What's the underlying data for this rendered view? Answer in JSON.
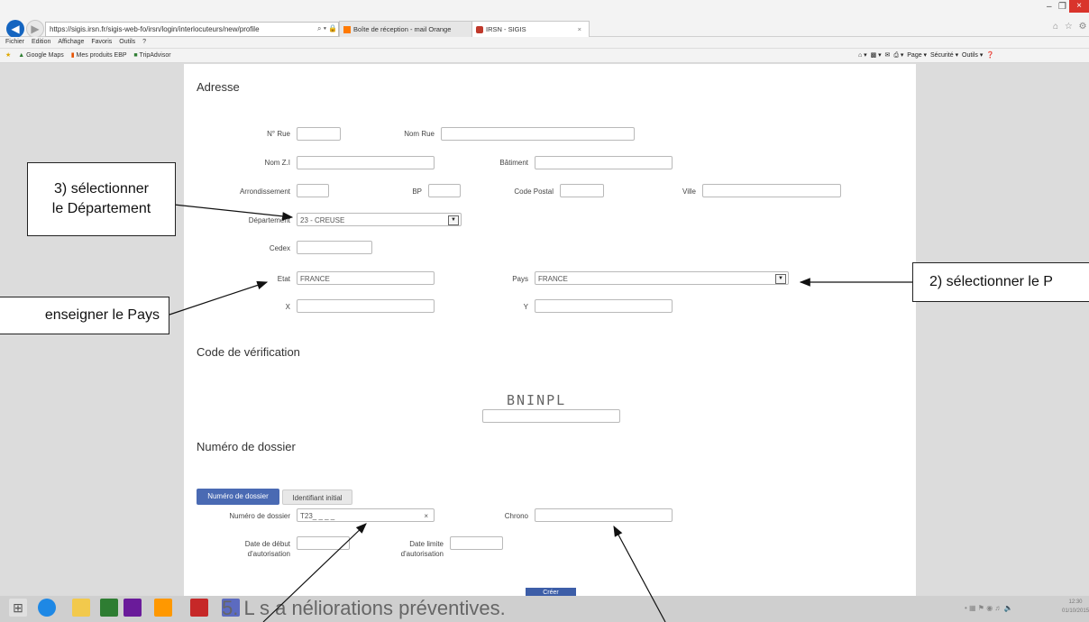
{
  "browser": {
    "url": "https://sigis.irsn.fr/sigis-web-fo/irsn/login/interlocuteurs/new/profile",
    "address_controls": "⌕ ▾ 🔒 C",
    "tabs": [
      {
        "label": "Boîte de réception - mail Orange"
      },
      {
        "label": "IRSN - SIGIS",
        "close": "×"
      }
    ],
    "window_controls": {
      "min": "–",
      "max": "❐",
      "close": "×"
    },
    "toolbar_icons": "⌂ ☆ ⚙",
    "menu": [
      "Fichier",
      "Edition",
      "Affichage",
      "Favoris",
      "Outils",
      "?"
    ],
    "favorites": [
      "Google Maps",
      "Mes produits EBP",
      "TripAdvisor"
    ],
    "command_bar": [
      "Page ▾",
      "Sécurité ▾",
      "Outils ▾"
    ]
  },
  "form": {
    "address_heading": "Adresse",
    "labels": {
      "num_rue": "N° Rue",
      "nom_rue": "Nom Rue",
      "nom_zi": "Nom Z.I",
      "batiment": "Bâtiment",
      "arrondissement": "Arrondissement",
      "bp": "BP",
      "code_postal": "Code Postal",
      "ville": "Ville",
      "departement": "Département",
      "cedex": "Cedex",
      "etat": "Etat",
      "pays": "Pays",
      "x": "X",
      "y": "Y"
    },
    "values": {
      "departement": "23 - CREUSE",
      "etat": "FRANCE",
      "pays": "FRANCE"
    },
    "verification_heading": "Code de vérification",
    "captcha": "BNINPL",
    "dossier_heading": "Numéro de dossier",
    "tab_dossier": "Numéro de dossier",
    "tab_identifiant": "Identifiant initial",
    "dossier_label": "Numéro de dossier",
    "dossier_value": "T23_ _ _ _",
    "clear_icon": "×",
    "chrono_label": "Chrono",
    "date_debut_label_1": "Date de début",
    "date_debut_label_2": "d'autorisation",
    "date_limite_label_1": "Date limite",
    "date_limite_label_2": "d'autorisation",
    "submit": "Créer"
  },
  "callouts": {
    "step3_line1": "3) sélectionner",
    "step3_line2": "le Département",
    "step2": "2) sélectionner le P",
    "step1": "enseigner le Pays"
  },
  "taskbar": {
    "bottom_text": "5. L  s a  néliorations préventives.",
    "clock_time": "12:30",
    "clock_date": "01/10/2015"
  },
  "colors": {
    "accent_blue": "#4a6ab3",
    "close_red": "#d9342b",
    "back_blue": "#1565c0"
  }
}
